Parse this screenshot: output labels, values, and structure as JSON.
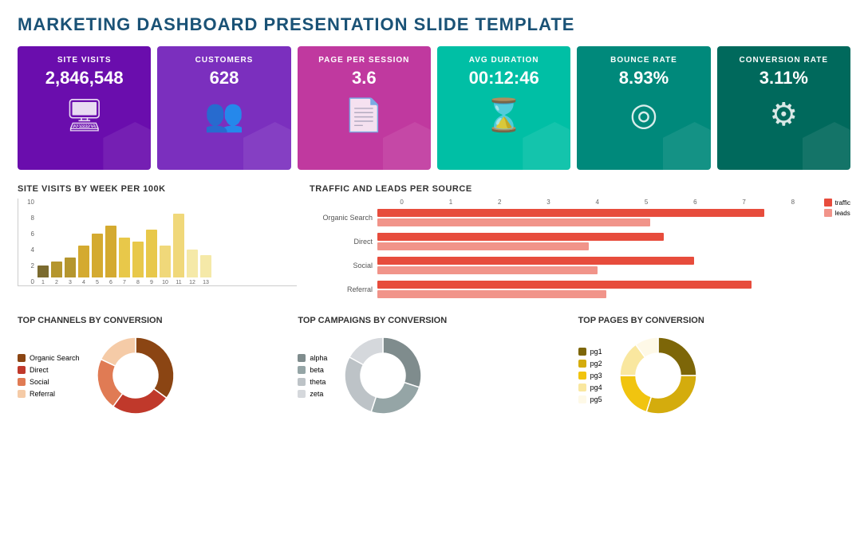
{
  "title": "MARKETING DASHBOARD PRESENTATION SLIDE TEMPLATE",
  "kpi_cards": [
    {
      "id": "site-visits",
      "label": "SITE VISITS",
      "value": "2,846,548",
      "color_class": "purple-dark",
      "icon": "🖥"
    },
    {
      "id": "customers",
      "label": "CUSTOMERS",
      "value": "628",
      "color_class": "purple-mid",
      "icon": "👥"
    },
    {
      "id": "page-per-session",
      "label": "PAGE PER SESSION",
      "value": "3.6",
      "color_class": "magenta",
      "icon": "📄"
    },
    {
      "id": "avg-duration",
      "label": "AVG DURATION",
      "value": "00:12:46",
      "color_class": "teal",
      "icon": "⌛"
    },
    {
      "id": "bounce-rate",
      "label": "BOUNCE RATE",
      "value": "8.93%",
      "color_class": "teal-dark",
      "icon": "◎"
    },
    {
      "id": "conversion-rate",
      "label": "CONVERSION RATE",
      "value": "3.11%",
      "color_class": "dark-teal",
      "icon": "⚙"
    }
  ],
  "site_visits_chart": {
    "title": "SITE VISITS by Week per 100k",
    "y_labels": [
      "10",
      "8",
      "6",
      "4",
      "2",
      "0"
    ],
    "bars": [
      {
        "label": "1",
        "height_pct": 15,
        "color": "#7b6b2f"
      },
      {
        "label": "2",
        "height_pct": 20,
        "color": "#b5962e"
      },
      {
        "label": "3",
        "height_pct": 25,
        "color": "#b5962e"
      },
      {
        "label": "4",
        "height_pct": 40,
        "color": "#d4aa30"
      },
      {
        "label": "5",
        "height_pct": 55,
        "color": "#d4aa30"
      },
      {
        "label": "6",
        "height_pct": 65,
        "color": "#d4aa30"
      },
      {
        "label": "7",
        "height_pct": 50,
        "color": "#e8c84a"
      },
      {
        "label": "8",
        "height_pct": 45,
        "color": "#e8c84a"
      },
      {
        "label": "9",
        "height_pct": 60,
        "color": "#e8c84a"
      },
      {
        "label": "10",
        "height_pct": 40,
        "color": "#f0d87a"
      },
      {
        "label": "11",
        "height_pct": 80,
        "color": "#f0d87a"
      },
      {
        "label": "12",
        "height_pct": 35,
        "color": "#f5e9a8"
      },
      {
        "label": "13",
        "height_pct": 28,
        "color": "#f5e9a8"
      }
    ]
  },
  "traffic_leads_chart": {
    "title": "TRAFFIC and LEADS Per Source",
    "x_labels": [
      "0",
      "1",
      "2",
      "3",
      "4",
      "5",
      "6",
      "7",
      "8"
    ],
    "rows": [
      {
        "label": "Organic Search",
        "traffic": 88,
        "leads": 62
      },
      {
        "label": "Direct",
        "traffic": 65,
        "leads": 48
      },
      {
        "label": "Social",
        "traffic": 72,
        "leads": 50
      },
      {
        "label": "Referral",
        "traffic": 85,
        "leads": 52
      }
    ],
    "legend": {
      "traffic_label": "traffic",
      "leads_label": "leads",
      "traffic_color": "#e74c3c",
      "leads_color": "#f1948a"
    }
  },
  "top_channels": {
    "title": "TOP CHANNELS by Conversion",
    "segments": [
      {
        "label": "Organic Search",
        "color": "#8b4513",
        "value": 35
      },
      {
        "label": "Direct",
        "color": "#c0392b",
        "value": 25
      },
      {
        "label": "Social",
        "color": "#e07b54",
        "value": 22
      },
      {
        "label": "Referral",
        "color": "#f5cba7",
        "value": 18
      }
    ]
  },
  "top_campaigns": {
    "title": "TOP CAMPAIGNS by Conversion",
    "segments": [
      {
        "label": "alpha",
        "color": "#7f8c8d",
        "value": 30
      },
      {
        "label": "beta",
        "color": "#95a5a6",
        "value": 25
      },
      {
        "label": "theta",
        "color": "#bdc3c7",
        "value": 28
      },
      {
        "label": "zeta",
        "color": "#d5d8dc",
        "value": 17
      }
    ]
  },
  "top_pages": {
    "title": "TOP PAGES by Conversion",
    "segments": [
      {
        "label": "pg1",
        "color": "#7d6608",
        "value": 25
      },
      {
        "label": "pg2",
        "color": "#d4ac0d",
        "value": 30
      },
      {
        "label": "pg3",
        "color": "#f1c40f",
        "value": 20
      },
      {
        "label": "pg4",
        "color": "#f9e79f",
        "value": 15
      },
      {
        "label": "pg5",
        "color": "#fef9e7",
        "value": 10
      }
    ]
  }
}
